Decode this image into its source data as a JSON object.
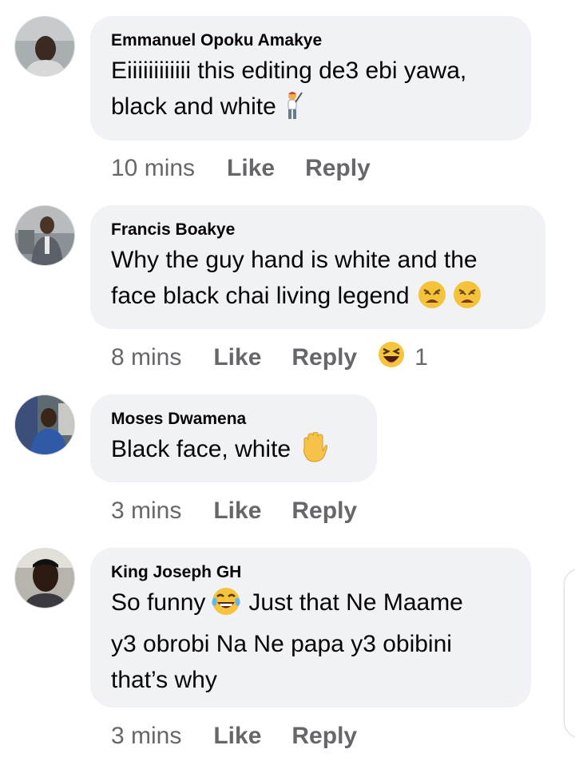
{
  "comments": [
    {
      "author": "Emmanuel Opoku Amakye",
      "text_line1": "Eiiiiiiiiiiii this editing de3 ebi yawa,",
      "text_line2": "black and white",
      "emoji": "golfer-emoji",
      "time": "10 mins",
      "like": "Like",
      "reply": "Reply"
    },
    {
      "author": "Francis Boakye",
      "text_line1": "Why the guy hand is white and the",
      "text_line2": "face black chai living legend",
      "emoji": "weary-face-emoji",
      "time": "8 mins",
      "like": "Like",
      "reply": "Reply",
      "reaction": {
        "icon": "haha-reaction-icon",
        "count": "1"
      }
    },
    {
      "author": "Moses Dwamena",
      "text_line1": "Black face, white",
      "emoji": "raised-hand-emoji",
      "time": "3 mins",
      "like": "Like",
      "reply": "Reply"
    },
    {
      "author": "King Joseph GH",
      "text_line1a": "So funny",
      "text_line1b": "Just that Ne Maame",
      "text_line2": "y3 obrobi Na Ne papa y3 obibini",
      "text_line3": "that’s why",
      "emoji": "tears-of-joy-emoji",
      "time": "3 mins",
      "like": "Like",
      "reply": "Reply"
    }
  ],
  "colors": {
    "bubble": "#f0f2f5",
    "meta_text": "#65676b",
    "body_text": "#050505"
  }
}
